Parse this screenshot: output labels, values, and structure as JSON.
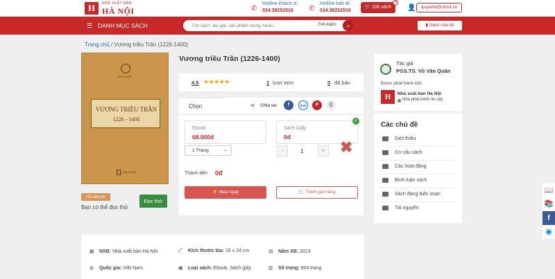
{
  "header": {
    "logo_mark": "H",
    "logo_small": "NHÀ XUẤT BẢN",
    "logo_big": "HÀ NỘI",
    "hotline_guest_label": "Hotline khách sỉ:",
    "hotline_guest_number": "024.38252916",
    "hotline_retail_label": "Hotline bán lẻ:",
    "hotline_retail_number": "024.38252916",
    "cart_label": "Giỏ sách",
    "cart_count": "0",
    "user_email": "quyenht@vhmt.vn"
  },
  "nav": {
    "menu_label": "DANH MỤC SÁCH",
    "search_placeholder": "Tìm sách, tác giả, sản phẩm mong muốn...",
    "search_button": "Tìm kiếm",
    "my_books": "Sách của tôi"
  },
  "breadcrumb": {
    "home": "Trang chủ",
    "current": "/ Vương triều Trần (1226-1400)"
  },
  "cover": {
    "publisher_top": "NXB HÀ NỘI",
    "title_line1": "VƯƠNG TRIỀU TRẦN",
    "title_line2": "1226 - 1400",
    "publisher_bottom": "NXB HÀ NỘI"
  },
  "left": {
    "ebook_tag": "Có ebook",
    "read_note": "Bạn có thể đọc thử",
    "read_button": "Đọc thử"
  },
  "book": {
    "title": "Vương triều Trần (1226-1400)",
    "rating": "4.5",
    "stars": "★★★★★",
    "views": "1",
    "views_label": "lượt xem",
    "sold": "0",
    "sold_label": "đã bán"
  },
  "purchase": {
    "tab_label": "Chọn",
    "share_label": "Chia sẻ:",
    "social": [
      "f",
      "Zalo",
      "P",
      "Q"
    ],
    "ebook_title": "Ebook",
    "ebook_price": "68.000đ",
    "duration": "1 Tháng",
    "paper_title": "Sách Giấy",
    "paper_price": "0đ",
    "quantity": "1",
    "minus": "-",
    "plus": "+",
    "total_label": "Thành tiền",
    "total_value": "0đ",
    "buy_now": "Mua ngay",
    "add_to_cart": "Thêm giỏ hàng"
  },
  "sidebar": {
    "author_label": "Tác giả",
    "author_name": "PGS.TS. Vũ Văn Quân",
    "publisher_label": "Được phát hành bởi:",
    "publisher_name": "Nhà xuất bản Hà Nội",
    "publisher_trust": "Nhà phát hành tin cậy",
    "topics_title": "Các chủ đề",
    "topics": [
      "Giới thiệu",
      "Cơ cấu sách",
      "Các hoạt động",
      "Bình luận sách",
      "Sách đang biên soạn",
      "Tài nguyên"
    ]
  },
  "info": {
    "nxb_label": "NXB:",
    "nxb_value": "Nhà xuất bản Hà Nội",
    "size_label": "Kích thước bìa:",
    "size_value": "16 x 24 cm",
    "year_label": "Năm XB:",
    "year_value": "2019",
    "country_label": "Quốc gia:",
    "country_value": "Việt Nam",
    "type_label": "Loại sách:",
    "type_value": "Ebook, Sách giấy",
    "pages_label": "Số trang:",
    "pages_value": "804 trang"
  },
  "colors": {
    "brand": "#c62828",
    "accent_green": "#388e3c",
    "star": "#f0a500"
  }
}
